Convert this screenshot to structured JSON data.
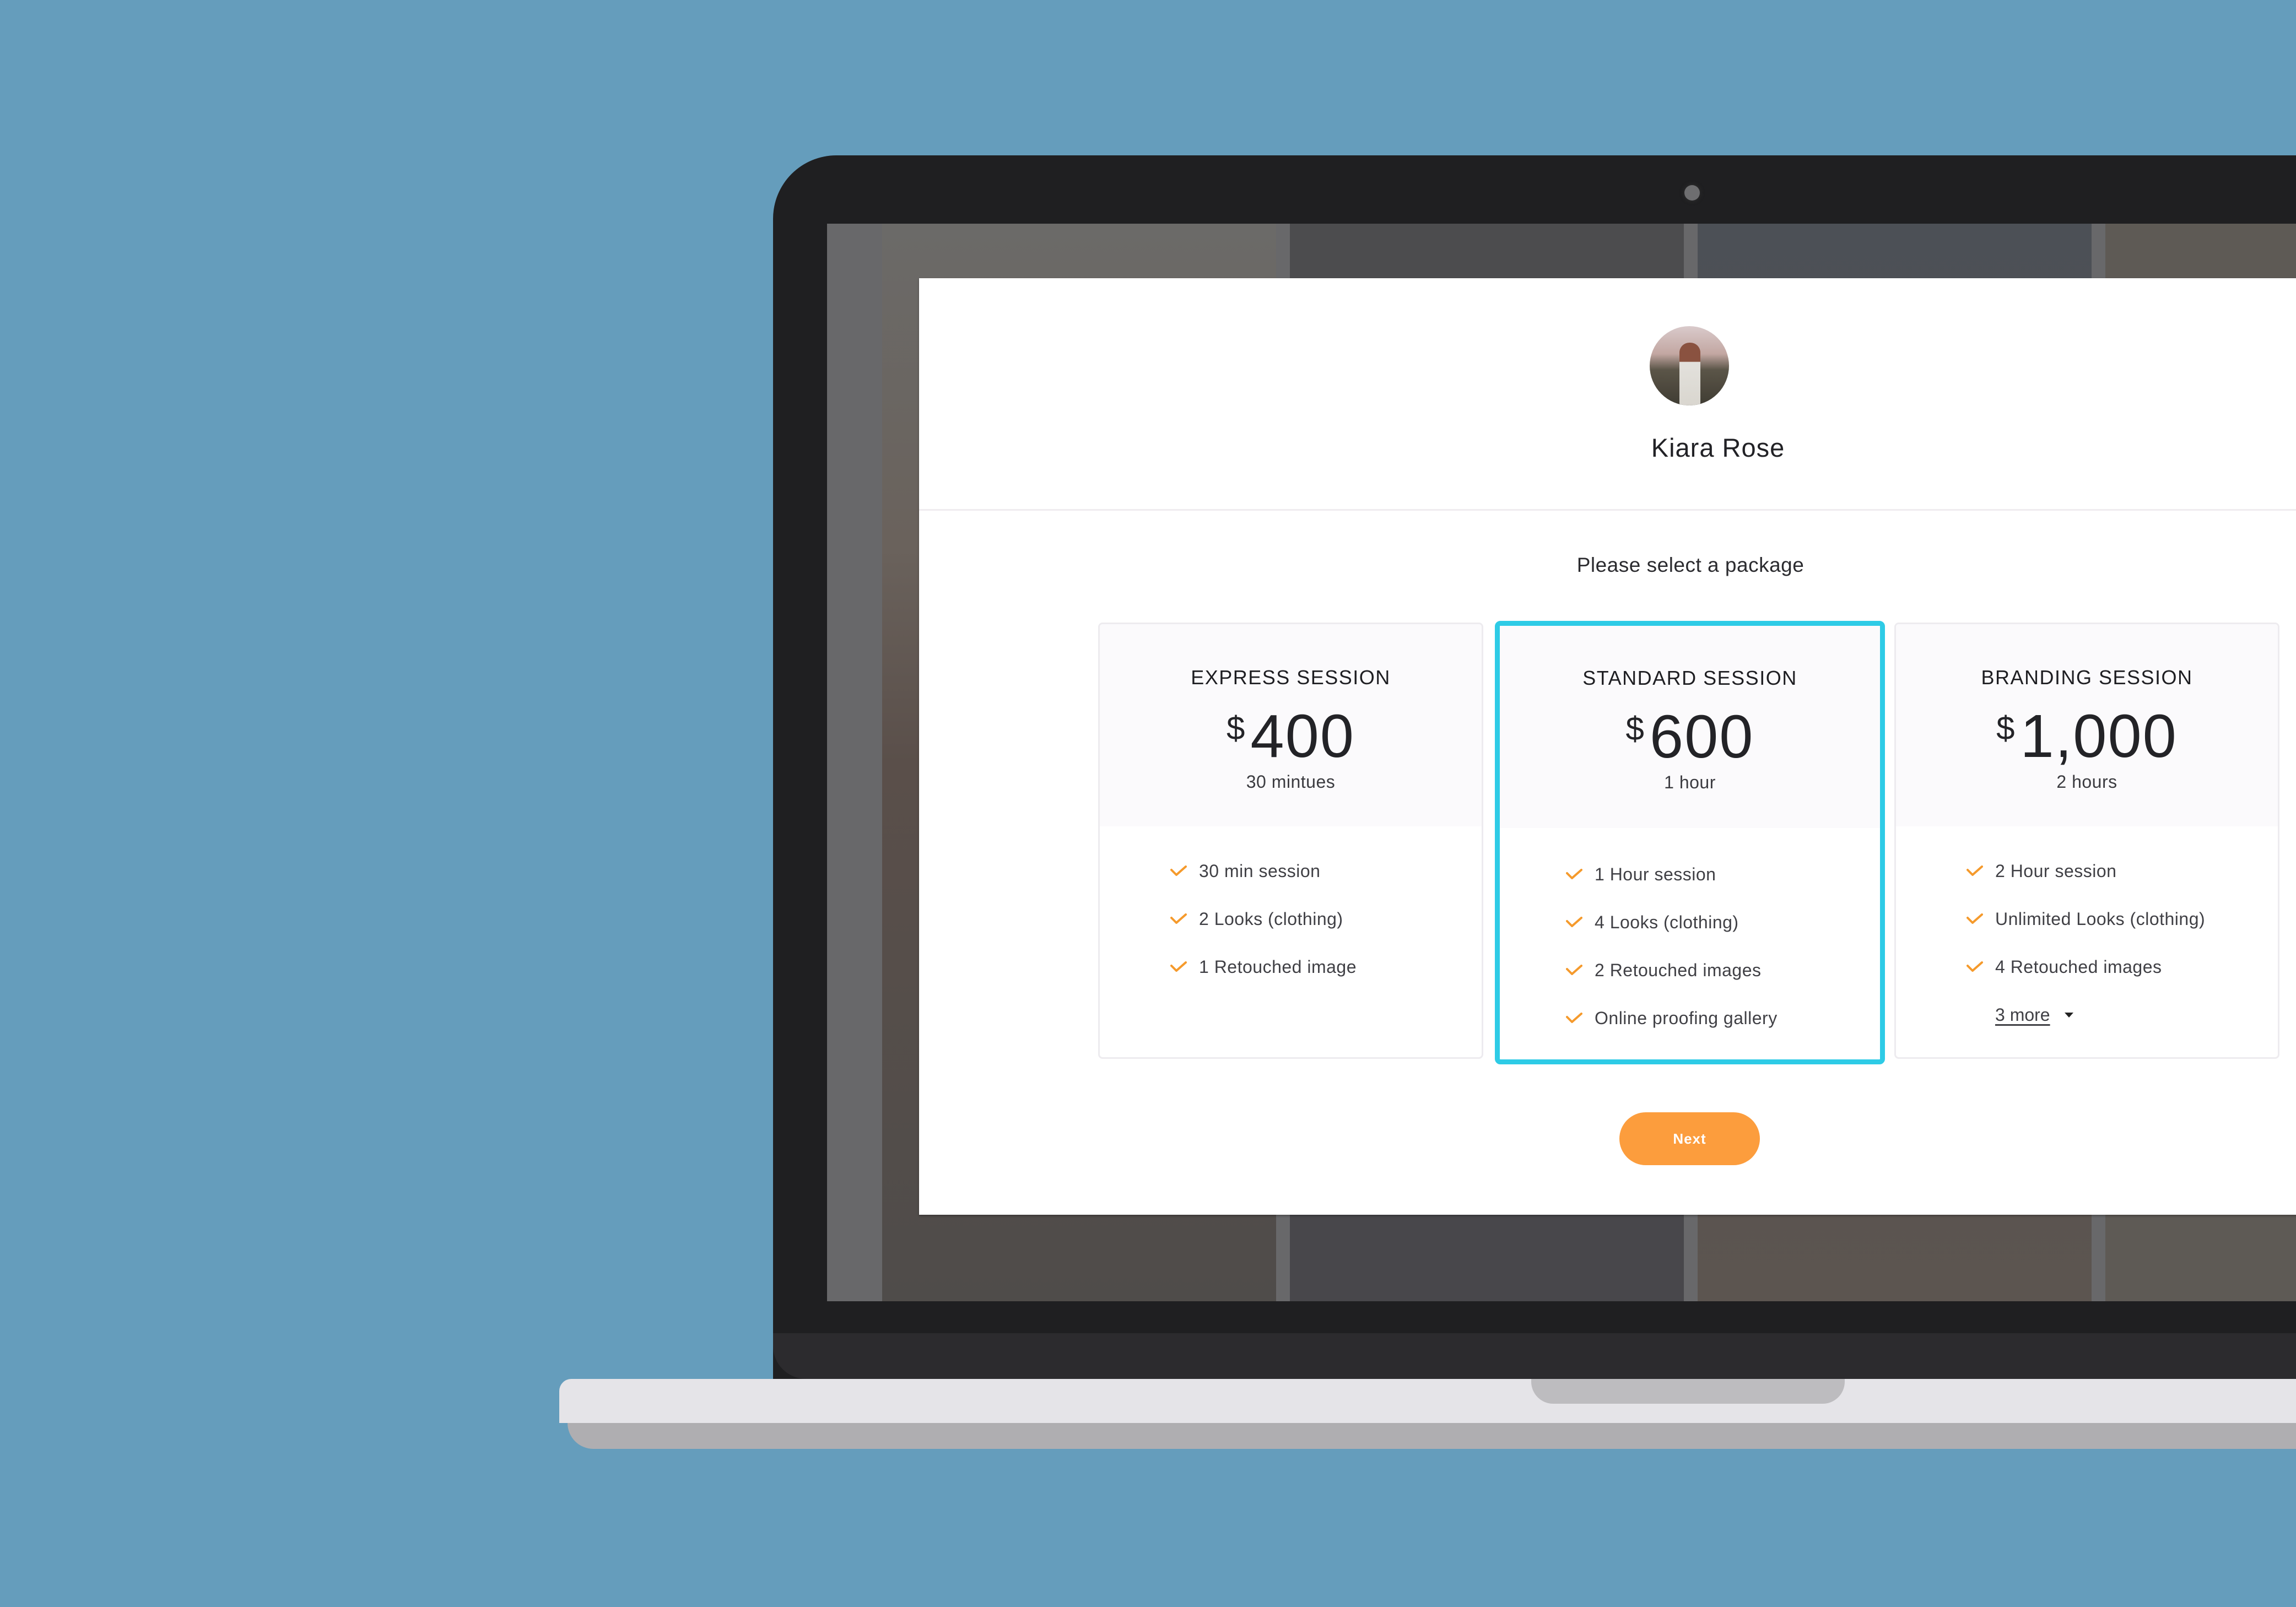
{
  "profile": {
    "name": "Kiara Rose",
    "avatar_icon": "profile-photo"
  },
  "prompt": "Please select a package",
  "colors": {
    "background": "#659DBC",
    "accent_selected": "#2ECBE6",
    "check": "#F59A2C",
    "button": "#FC9D3D"
  },
  "packages": [
    {
      "title": "EXPRESS SESSION",
      "currency": "$",
      "price": "400",
      "duration": "30 mintues",
      "selected": false,
      "features": [
        "30 min session",
        "2 Looks (clothing)",
        "1 Retouched image"
      ]
    },
    {
      "title": "STANDARD SESSION",
      "currency": "$",
      "price": "600",
      "duration": "1 hour",
      "selected": true,
      "features": [
        "1 Hour session",
        "4 Looks (clothing)",
        "2 Retouched images",
        "Online proofing gallery"
      ]
    },
    {
      "title": "BRANDING SESSION",
      "currency": "$",
      "price": "1,000",
      "duration": "2 hours",
      "selected": false,
      "features": [
        "2 Hour session",
        "Unlimited Looks (clothing)",
        "4 Retouched images"
      ],
      "more_label": "3 more"
    }
  ],
  "actions": {
    "next_label": "Next"
  }
}
